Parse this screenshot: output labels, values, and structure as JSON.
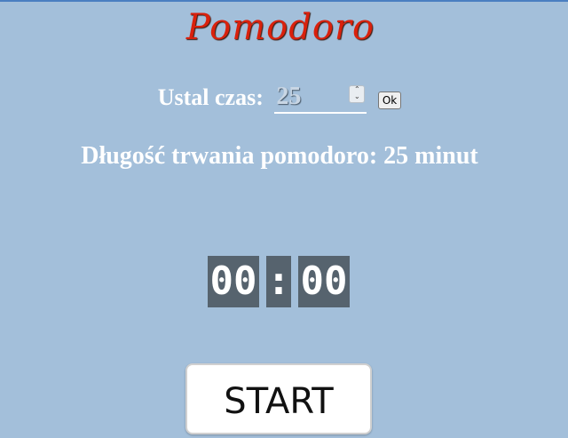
{
  "header": {
    "title": "Pomodoro"
  },
  "settings": {
    "label": "Ustal czas:",
    "time_value": "25",
    "ok_label": "Ok"
  },
  "status": {
    "duration_text": "Długość trwania pomodoro: 25 minut"
  },
  "timer": {
    "minutes": "00",
    "separator": ":",
    "seconds": "00"
  },
  "controls": {
    "start_label": "START"
  },
  "colors": {
    "background": "#a3bfda",
    "title": "#d9210d",
    "timer_box": "#56636e"
  }
}
